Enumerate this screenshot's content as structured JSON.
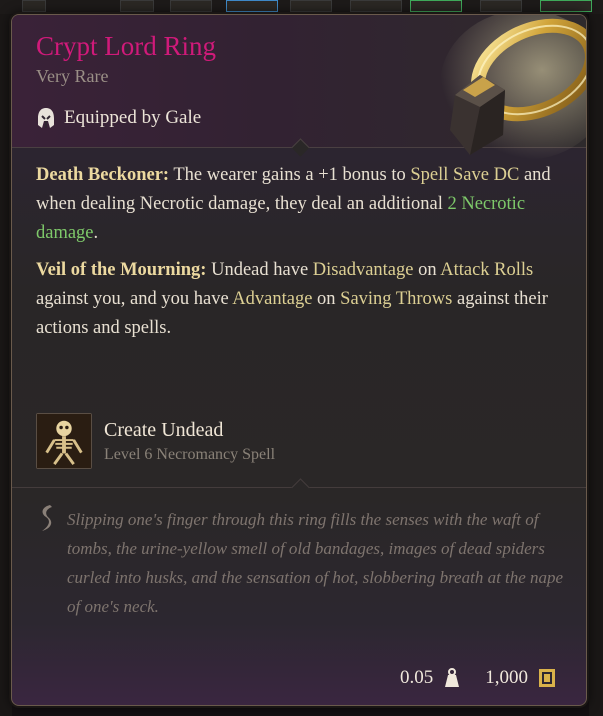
{
  "item": {
    "name": "Crypt Lord Ring",
    "rarity": "Very Rare",
    "equipped": "Equipped by Gale",
    "abilities": [
      {
        "name": "Death Beckoner:",
        "parts": [
          " The wearer gains a +1 bonus to ",
          "Spell Save DC",
          " and when dealing Necrotic damage, they deal an additional ",
          "2 Necrotic damage",
          "."
        ]
      },
      {
        "name": "Veil of the Mourning:",
        "parts": [
          " Undead have ",
          "Disadvantage",
          " on ",
          "Attack Rolls",
          " against you, and you have ",
          "Advantage",
          " on ",
          "Saving Throws",
          " against their actions and spells."
        ]
      }
    ],
    "spell": {
      "name": "Create Undead",
      "level": "Level 6 Necromancy Spell",
      "icon": "skeleton-icon"
    },
    "lore": "Slipping one's finger through this ring fills the senses with the waft of tombs, the urine-yellow smell of old bandages, images of dead spiders curled into husks, and the sensation of hot, slobbering breath at the nape of one's neck.",
    "weight": "0.05",
    "value": "1,000"
  },
  "icons": {
    "equipped": "helmet-icon",
    "lore": "quill-icon",
    "weight": "weight-icon",
    "gold": "gold-icon",
    "ring": "ring-art"
  },
  "colors": {
    "title": "#d01a7a",
    "keyword": "#dccf93",
    "necrotic": "#7ec96a"
  }
}
